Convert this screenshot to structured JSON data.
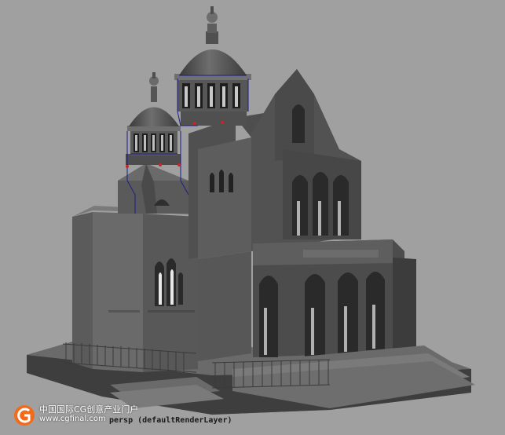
{
  "viewport": {
    "camera_label": "persp (defaultRenderLayer)",
    "background_color": "#a0a0a0"
  },
  "watermark": {
    "title": "中国国际CG创意产业门户",
    "url": "www.cgfinal.com",
    "logo_icon": "cgfinal-logo-icon",
    "logo_color": "#f26a1b"
  },
  "model": {
    "subject": "church-building-3d-model",
    "shading": "smooth-shaded-grey",
    "selection_edge_color": "#1c1c8c",
    "selected_vertex_color": "#d42020"
  }
}
